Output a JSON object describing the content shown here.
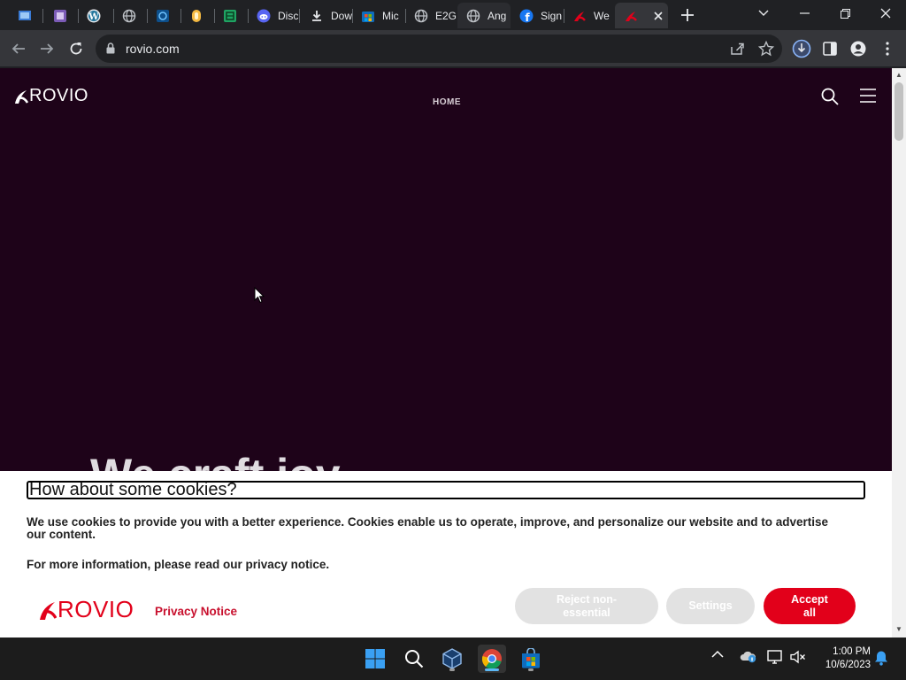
{
  "browser": {
    "tabs": [
      {
        "label": "",
        "icon": "windows-app-icon"
      },
      {
        "label": "",
        "icon": "purple-app-icon"
      },
      {
        "label": "",
        "icon": "wordpress-icon"
      },
      {
        "label": "",
        "icon": "globe-icon"
      },
      {
        "label": "",
        "icon": "blue-square-icon"
      },
      {
        "label": "",
        "icon": "orange-app-icon"
      },
      {
        "label": "",
        "icon": "green-sheet-icon"
      },
      {
        "label": "Disc",
        "icon": "discord-icon"
      },
      {
        "label": "Dow",
        "icon": "download-icon"
      },
      {
        "label": "Mic",
        "icon": "microsoft-store-icon"
      },
      {
        "label": "E2G",
        "icon": "globe-icon"
      },
      {
        "label": "Ang",
        "icon": "globe-icon"
      },
      {
        "label": "Sign",
        "icon": "facebook-icon"
      },
      {
        "label": "We",
        "icon": "rovio-icon"
      },
      {
        "label": "",
        "icon": "rovio-icon",
        "active": true
      }
    ],
    "url": "rovio.com"
  },
  "site": {
    "logo_text": "ROVIO",
    "nav_home": "HOME",
    "hero_text": "We craft joy"
  },
  "cookie_banner": {
    "title": "How about some cookies?",
    "text1": "We use cookies to provide you with a better experience. Cookies enable us to operate, improve, and personalize our website and to advertise our content.",
    "text2": "For more information, please read our privacy notice.",
    "logo_text": "ROVIO",
    "privacy_link": "Privacy Notice",
    "reject_label": "Reject non-essential",
    "settings_label": "Settings",
    "accept_label": "Accept all"
  },
  "taskbar": {
    "time": "1:00 PM",
    "date": "10/6/2023"
  },
  "colors": {
    "page_bg": "#1e0319",
    "brand_red": "#e2001a",
    "browser_dark": "#202124",
    "toolbar": "#35363a"
  }
}
